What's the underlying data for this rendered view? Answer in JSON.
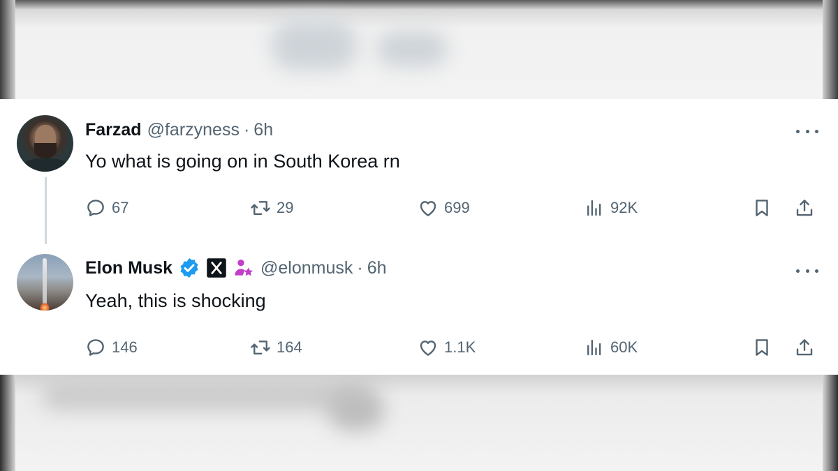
{
  "tweets": [
    {
      "name": "Farzad",
      "handle": "@farzyness",
      "separator": "·",
      "time": "6h",
      "text": "Yo what is going on in South Korea rn",
      "stats": {
        "replies": "67",
        "retweets": "29",
        "likes": "699",
        "views": "92K"
      },
      "badges": []
    },
    {
      "name": "Elon Musk",
      "handle": "@elonmusk",
      "separator": "·",
      "time": "6h",
      "text": "Yeah, this is shocking",
      "stats": {
        "replies": "146",
        "retweets": "164",
        "likes": "1.1K",
        "views": "60K"
      },
      "badges": [
        "verified-badge-icon",
        "x-affiliate-icon",
        "subscriber-person-star-icon"
      ]
    }
  ],
  "colors": {
    "text_primary": "#0f1419",
    "text_secondary": "#536471",
    "verified_blue": "#1d9bf0",
    "subscriber_purple": "#c13ec9",
    "thread_line": "#cfd9de"
  }
}
